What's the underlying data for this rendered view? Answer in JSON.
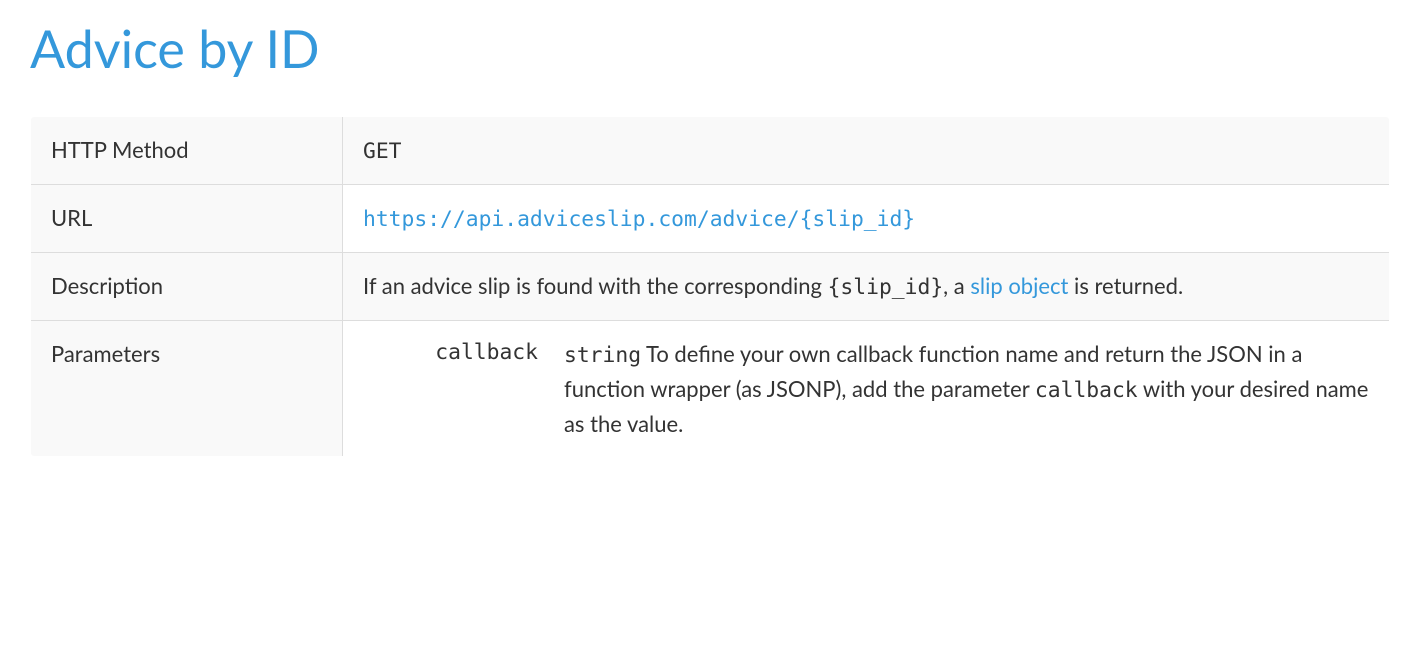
{
  "heading": "Advice by ID",
  "rows": {
    "http_method": {
      "label": "HTTP Method",
      "value": "GET"
    },
    "url": {
      "label": "URL",
      "value": "https://api.adviceslip.com/advice/{slip_id}"
    },
    "description": {
      "label": "Description",
      "before": "If an advice slip is found with the corresponding ",
      "code": "{slip_id}",
      "middle": ", a ",
      "link_text": "slip object",
      "after": " is returned."
    },
    "parameters": {
      "label": "Parameters",
      "name": "callback",
      "type": "string",
      "desc_before": " To define your own callback function name and return the JSON in a function wrapper (as JSONP), add the parameter ",
      "desc_code": "callback",
      "desc_after": " with your desired name as the value."
    }
  }
}
